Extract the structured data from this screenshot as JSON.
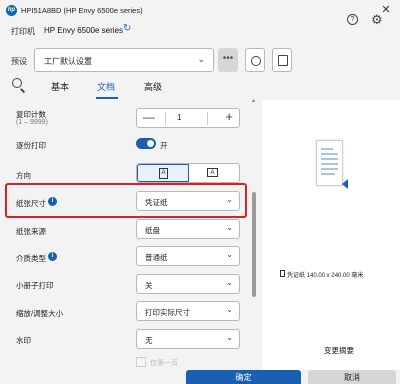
{
  "window": {
    "title": "HPI51A8BD (HP Envy 6500e series)",
    "close": "✕"
  },
  "header": {
    "printer_label": "打印机",
    "printer_name": "HP Envy 6500e series",
    "preset_label": "预设",
    "preset_value": "工厂默认设置",
    "more_label": "•••"
  },
  "tabs": [
    {
      "label": "基本"
    },
    {
      "label": "文档"
    },
    {
      "label": "高级"
    }
  ],
  "settings": {
    "copies_label": "复印计数",
    "copies_range": "(1 – 9999)",
    "copies_value": "1",
    "collate_label": "逐份打印",
    "collate_state": "开",
    "orientation_label": "方向",
    "paper_size_label": "纸张尺寸",
    "paper_size_value": "凭证纸",
    "paper_source_label": "纸张来源",
    "paper_source_value": "纸盘",
    "media_type_label": "介质类型",
    "media_type_value": "普通纸",
    "booklet_label": "小册子打印",
    "booklet_value": "关",
    "scaling_label": "缩放/调整大小",
    "scaling_value": "打印实际尺寸",
    "watermark_label": "水印",
    "watermark_value": "无",
    "watermark_option": "仅第一页"
  },
  "preview": {
    "size_text": "凭证纸  140.00 x 240.00  毫米",
    "change_summary": "变更摘要"
  },
  "footer": {
    "ok_label": "确定",
    "cancel_label": "取消"
  },
  "colors": {
    "accent": "#1a5fb4",
    "highlight": "#e02020"
  }
}
